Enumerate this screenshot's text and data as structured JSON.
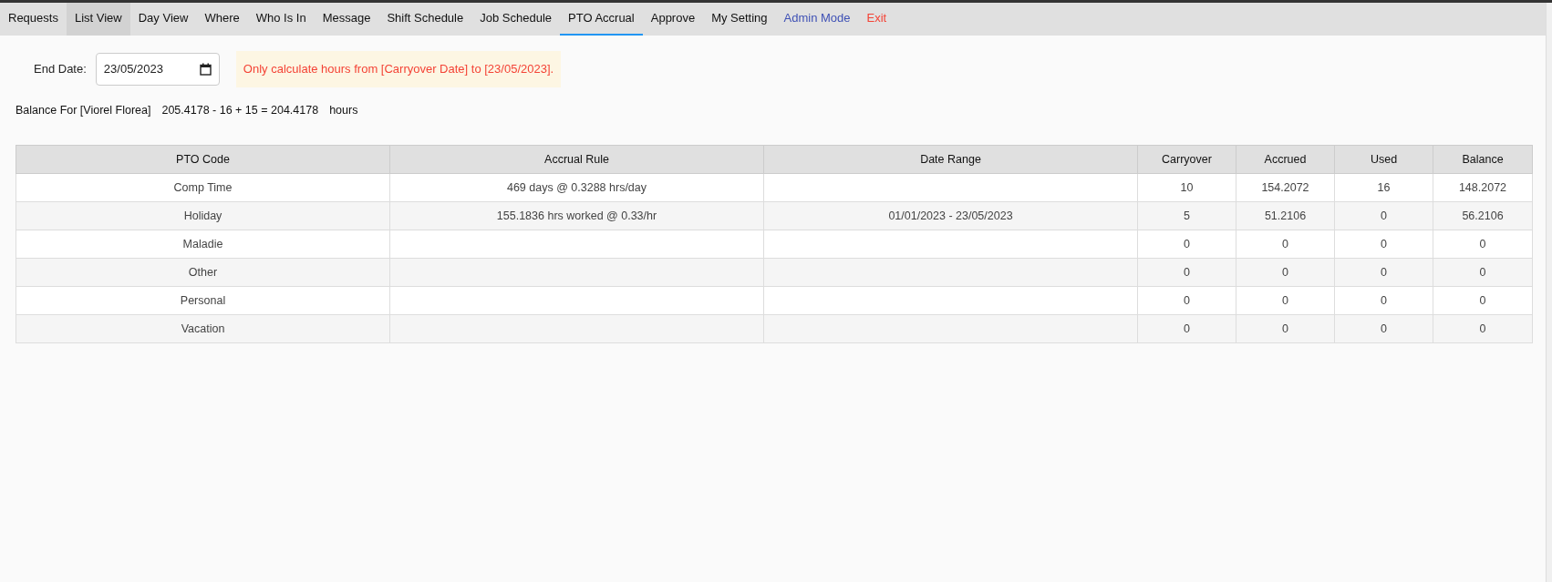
{
  "nav": {
    "tabs": [
      {
        "label": "Requests",
        "kind": "normal",
        "selected": false,
        "hovered": false
      },
      {
        "label": "List View",
        "kind": "normal",
        "selected": false,
        "hovered": true
      },
      {
        "label": "Day View",
        "kind": "normal",
        "selected": false,
        "hovered": false
      },
      {
        "label": "Where",
        "kind": "normal",
        "selected": false,
        "hovered": false
      },
      {
        "label": "Who Is In",
        "kind": "normal",
        "selected": false,
        "hovered": false
      },
      {
        "label": "Message",
        "kind": "normal",
        "selected": false,
        "hovered": false
      },
      {
        "label": "Shift Schedule",
        "kind": "normal",
        "selected": false,
        "hovered": false
      },
      {
        "label": "Job Schedule",
        "kind": "normal",
        "selected": false,
        "hovered": false
      },
      {
        "label": "PTO Accrual",
        "kind": "normal",
        "selected": true,
        "hovered": false
      },
      {
        "label": "Approve",
        "kind": "normal",
        "selected": false,
        "hovered": false
      },
      {
        "label": "My Setting",
        "kind": "normal",
        "selected": false,
        "hovered": false
      },
      {
        "label": "Admin Mode",
        "kind": "admin",
        "selected": false,
        "hovered": false
      },
      {
        "label": "Exit",
        "kind": "exit",
        "selected": false,
        "hovered": false
      }
    ]
  },
  "end_date": {
    "label": "End Date:",
    "value": "23/05/2023"
  },
  "notice": "Only calculate hours from [Carryover Date] to [23/05/2023].",
  "balance": {
    "label": "Balance For [Viorel Florea]",
    "formula": "205.4178 - 16 + 15 = 204.4178",
    "unit": "hours"
  },
  "table": {
    "columns": [
      "PTO Code",
      "Accrual Rule",
      "Date Range",
      "Carryover",
      "Accrued",
      "Used",
      "Balance"
    ],
    "rows": [
      [
        "Comp Time",
        "469 days @ 0.3288 hrs/day",
        "",
        "10",
        "154.2072",
        "16",
        "148.2072"
      ],
      [
        "Holiday",
        "155.1836 hrs worked @ 0.33/hr",
        "01/01/2023 - 23/05/2023",
        "5",
        "51.2106",
        "0",
        "56.2106"
      ],
      [
        "Maladie",
        "",
        "",
        "0",
        "0",
        "0",
        "0"
      ],
      [
        "Other",
        "",
        "",
        "0",
        "0",
        "0",
        "0"
      ],
      [
        "Personal",
        "",
        "",
        "0",
        "0",
        "0",
        "0"
      ],
      [
        "Vacation",
        "",
        "",
        "0",
        "0",
        "0",
        "0"
      ]
    ]
  }
}
